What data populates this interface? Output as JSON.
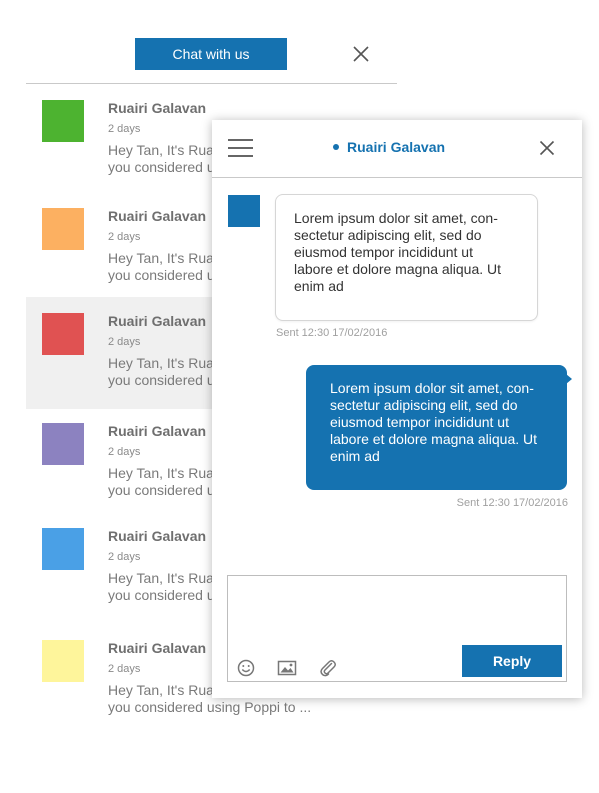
{
  "list": {
    "chat_button_label": "Chat with us",
    "conversations": [
      {
        "name": "Ruairi Galavan",
        "time": "2 days",
        "snippet_line1": "Hey Tan, It's Ruairi here. Have you",
        "snippet_line2": "you considered using Poppi to ...",
        "avatar_color": "#4db330",
        "active": false
      },
      {
        "name": "Ruairi Galavan",
        "time": "2 days",
        "snippet_line1": "Hey Tan, It's Ruairi here. Have you",
        "snippet_line2": "you considered using Poppi to ...",
        "avatar_color": "#fcb061",
        "active": false
      },
      {
        "name": "Ruairi Galavan",
        "time": "2 days",
        "snippet_line1": "Hey Tan, It's Ruairi here. Have you",
        "snippet_line2": "you considered using Poppi to ...",
        "avatar_color": "#e05252",
        "active": true
      },
      {
        "name": "Ruairi Galavan",
        "time": "2 days",
        "snippet_line1": "Hey Tan, It's Ruairi here. Have you",
        "snippet_line2": "you considered using Poppi to ...",
        "avatar_color": "#8c82c0",
        "active": false
      },
      {
        "name": "Ruairi Galavan",
        "time": "2 days",
        "snippet_line1": "Hey Tan, It's Ruairi here. Have you",
        "snippet_line2": "you considered using Poppi to ...",
        "avatar_color": "#4aa0e6",
        "active": false
      },
      {
        "name": "Ruairi Galavan",
        "time": "2 days",
        "snippet_line1": "Hey Tan, It's Ruairi here. Have you",
        "snippet_line2": "you considered using Poppi to ...",
        "avatar_color": "#fef59b",
        "active": false
      }
    ]
  },
  "chat": {
    "contact_name": "Ruairi Galavan",
    "incoming": {
      "lines": [
        "Lorem ipsum dolor sit amet, con-",
        "sectetur adipiscing elit, sed do",
        "eiusmod tempor incididunt ut",
        "labore et dolore magna aliqua. Ut",
        "enim ad"
      ],
      "sent": "Sent 12:30 17/02/2016"
    },
    "outgoing": {
      "lines": [
        "Lorem ipsum dolor sit amet, con-",
        "sectetur adipiscing elit, sed do",
        "eiusmod tempor incididunt ut",
        "labore et dolore magna aliqua. Ut",
        "enim ad"
      ],
      "sent": "Sent 12:30 17/02/2016"
    },
    "reply": {
      "input_value": "",
      "button_label": "Reply"
    }
  },
  "colors": {
    "accent": "#1572b0",
    "active_row": "#f0f0f0"
  },
  "icons": [
    "close-icon",
    "menu-icon",
    "status-dot-icon",
    "emoji-icon",
    "image-icon",
    "attachment-icon"
  ]
}
